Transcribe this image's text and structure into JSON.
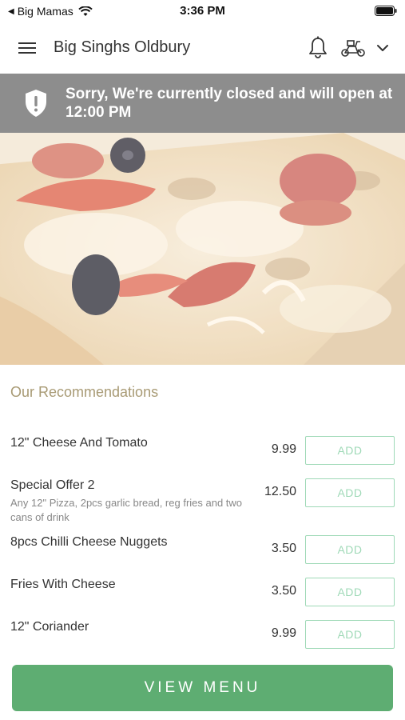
{
  "status_bar": {
    "back_app": "Big Mamas",
    "time": "3:36 PM"
  },
  "header": {
    "store_name": "Big Singhs Oldbury"
  },
  "banner": {
    "message": "Sorry, We're currently closed and will open at 12:00 PM"
  },
  "recommendations": {
    "title": "Our Recommendations",
    "items": [
      {
        "name": "12\" Cheese And Tomato",
        "description": "",
        "price": "9.99",
        "add_label": "ADD"
      },
      {
        "name": "Special Offer 2",
        "description": "Any 12\" Pizza, 2pcs garlic bread, reg fries and two cans of drink",
        "price": "12.50",
        "add_label": "ADD"
      },
      {
        "name": "8pcs Chilli Cheese Nuggets",
        "description": "",
        "price": "3.50",
        "add_label": "ADD"
      },
      {
        "name": "Fries With Cheese",
        "description": "",
        "price": "3.50",
        "add_label": "ADD"
      },
      {
        "name": "12\" Coriander",
        "description": "",
        "price": "9.99",
        "add_label": "ADD"
      }
    ]
  },
  "footer": {
    "view_menu_label": "VIEW MENU"
  },
  "colors": {
    "banner_bg": "#8d8d8d",
    "accent_green": "#5ead72",
    "add_button_border": "#9fd9b7",
    "section_title": "#a89a74"
  }
}
